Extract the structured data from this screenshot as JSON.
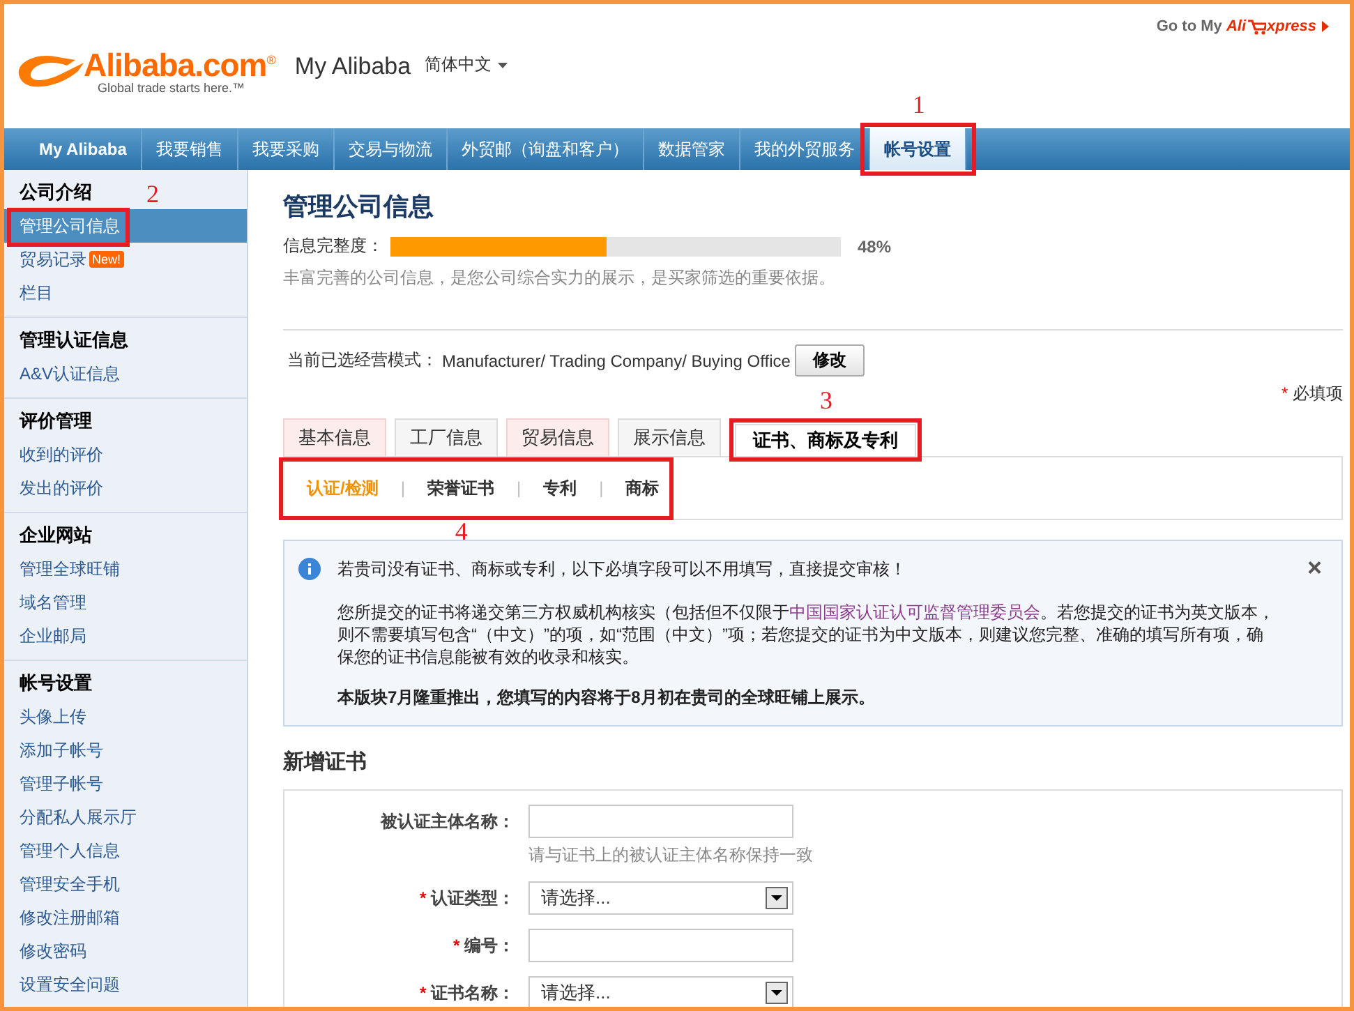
{
  "header": {
    "logo_text": "Alibaba.com$^{®}$",
    "logo_tagline": "Global trade starts here.™",
    "title": "My Alibaba",
    "language": "简体中文",
    "aliexpress_link": {
      "prefix": "Go to My",
      "brand_start": "Ali",
      "brand_end": "xpress"
    }
  },
  "nav": [
    {
      "label": "My Alibaba",
      "selected": false
    },
    {
      "label": "我要销售",
      "selected": false
    },
    {
      "label": "我要采购",
      "selected": false
    },
    {
      "label": "交易与物流",
      "selected": false
    },
    {
      "label": "外贸邮（询盘和客户）",
      "selected": false
    },
    {
      "label": "数据管家",
      "selected": false
    },
    {
      "label": "我的外贸服务",
      "selected": false
    },
    {
      "label": "帐号设置",
      "selected": true,
      "annotation": "1"
    }
  ],
  "sidebar": [
    {
      "title": "公司介绍",
      "items": [
        {
          "label": "管理公司信息",
          "selected": true,
          "annotation": "2"
        },
        {
          "label": "贸易记录",
          "selected": false,
          "badge": "New!"
        },
        {
          "label": "栏目",
          "selected": false
        }
      ]
    },
    {
      "title": "管理认证信息",
      "items": [
        {
          "label": "A&V认证信息",
          "selected": false
        }
      ]
    },
    {
      "title": "评价管理",
      "items": [
        {
          "label": "收到的评价",
          "selected": false
        },
        {
          "label": "发出的评价",
          "selected": false
        }
      ]
    },
    {
      "title": "企业网站",
      "items": [
        {
          "label": "管理全球旺铺",
          "selected": false
        },
        {
          "label": "域名管理",
          "selected": false
        },
        {
          "label": "企业邮局",
          "selected": false
        }
      ]
    },
    {
      "title": "帐号设置",
      "items": [
        {
          "label": "头像上传",
          "selected": false
        },
        {
          "label": "添加子帐号",
          "selected": false
        },
        {
          "label": "管理子帐号",
          "selected": false
        },
        {
          "label": "分配私人展示厅",
          "selected": false
        },
        {
          "label": "管理个人信息",
          "selected": false
        },
        {
          "label": "管理安全手机",
          "selected": false
        },
        {
          "label": "修改注册邮箱",
          "selected": false
        },
        {
          "label": "修改密码",
          "selected": false
        },
        {
          "label": "设置安全问题",
          "selected": false
        }
      ]
    }
  ],
  "main": {
    "title": "管理公司信息",
    "completeness": {
      "label": "信息完整度：",
      "level": 0.48,
      "reading": "48%"
    },
    "hint": "丰富完善的公司信息，是您公司综合实力的展示，是买家筛选的重要依据。",
    "mode": {
      "label": "当前已选经营模式：",
      "value": "Manufacturer/ Trading Company/ Buying Office",
      "button": "修改"
    },
    "required_note": {
      "mark": "*",
      "text": "必填项"
    },
    "tabs": [
      {
        "label": "基本信息",
        "selected": false,
        "incomplete": true
      },
      {
        "label": "工厂信息",
        "selected": false,
        "incomplete": false
      },
      {
        "label": "贸易信息",
        "selected": false,
        "incomplete": true
      },
      {
        "label": "展示信息",
        "selected": false,
        "incomplete": false
      },
      {
        "label": "证书、商标及专利",
        "selected": true,
        "incomplete": false,
        "annotation": "3"
      }
    ],
    "subtabs_annotation": "4",
    "subtabs": [
      {
        "label": "认证/检测",
        "selected": true
      },
      {
        "label": "荣誉证书",
        "selected": false
      },
      {
        "label": "专利",
        "selected": false
      },
      {
        "label": "商标",
        "selected": false
      }
    ],
    "subtab_separator": "|",
    "notice": {
      "close": "×",
      "heading": "若贵司没有证书、商标或专利，以下必填字段可以不用填写，直接提交审核！",
      "body_start": "您所提交的证书将递交第三方权威机构核实（包括但不仅限于",
      "link": "中国国家认证认可监督管理委员会",
      "body_end": "。若您提交的证书为英文版本，则不需要填写包含“（中文）”的项，如“范围（中文）”项；若您提交的证书为中文版本，则建议您完整、准确的填写所有项，确保您的证书信息能被有效的收录和核实。",
      "footer": "本版块7月隆重推出，您填写的内容将于8月初在贵司的全球旺铺上展示。"
    },
    "form": {
      "title": "新增证书",
      "fields": [
        {
          "kind": "text",
          "label": "被认证主体名称：",
          "required": false,
          "hint": "请与证书上的被认证主体名称保持一致"
        },
        {
          "kind": "select",
          "label": "认证类型：",
          "required": true,
          "value": "请选择..."
        },
        {
          "kind": "text",
          "label": "编号：",
          "required": true
        },
        {
          "kind": "select",
          "label": "证书名称：",
          "required": true,
          "value": "请选择..."
        }
      ]
    }
  }
}
